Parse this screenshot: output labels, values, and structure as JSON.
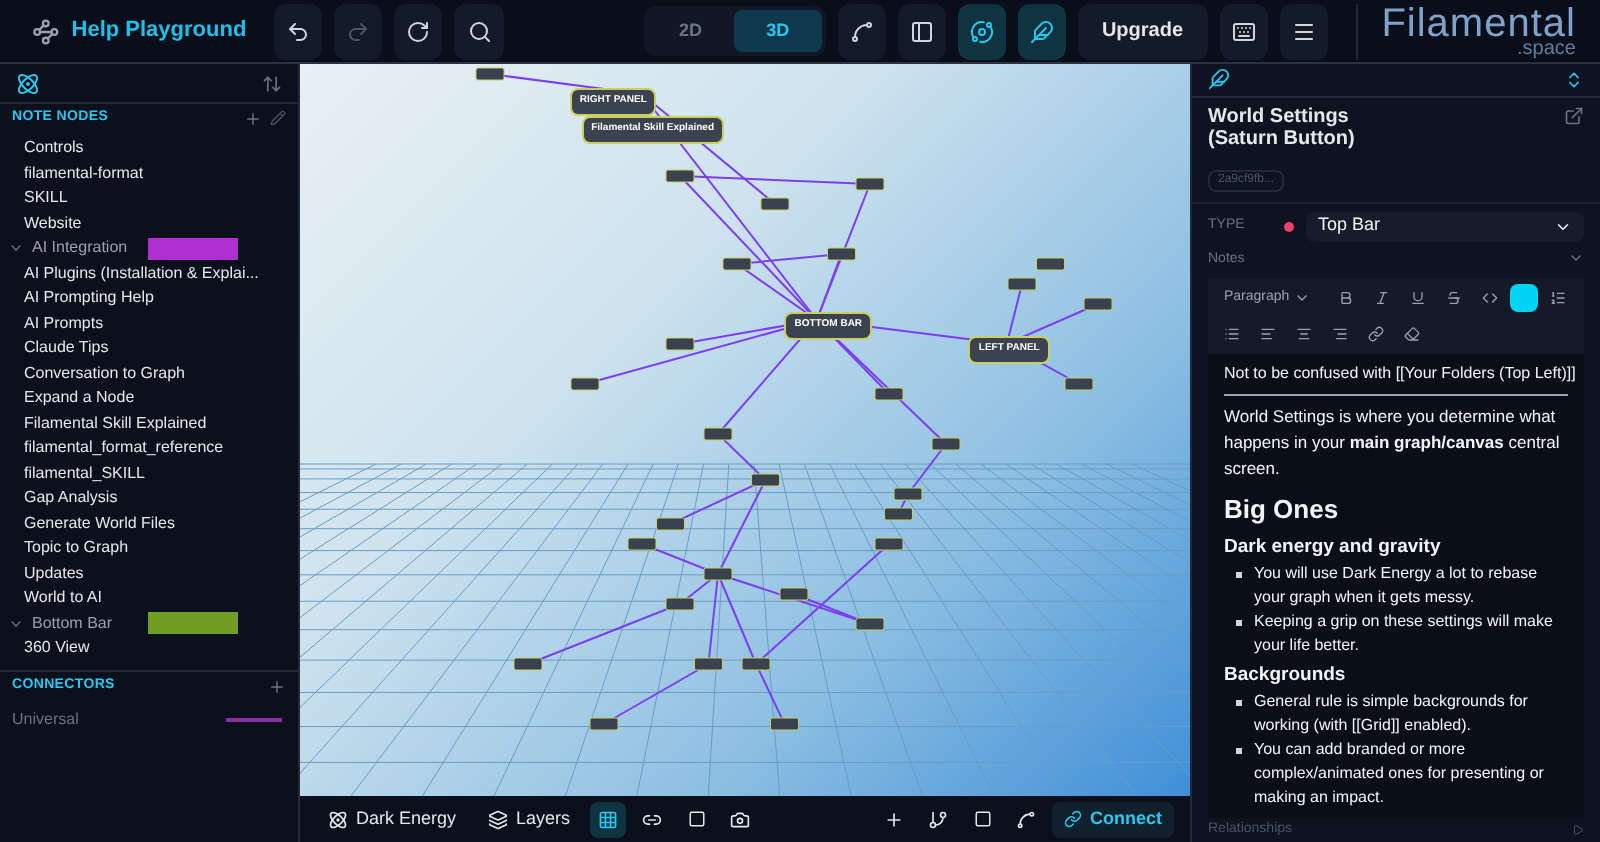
{
  "top_bar": {
    "title": "Help Playground",
    "view_modes": [
      {
        "label": "2D",
        "selected": false
      },
      {
        "label": "3D",
        "selected": true
      }
    ],
    "upgrade": "Upgrade",
    "logo": "Filamental",
    "logo_sub": ".space"
  },
  "sidebar": {
    "sections": [
      {
        "title": "NOTE NODES",
        "items": [
          {
            "kind": "item",
            "label": "Controls"
          },
          {
            "kind": "item",
            "label": "filamental-format"
          },
          {
            "kind": "item",
            "label": "SKILL"
          },
          {
            "kind": "item",
            "label": "Website"
          },
          {
            "kind": "group",
            "label": "AI Integration",
            "color": "#b02fd0",
            "expanded": true,
            "children": [
              {
                "kind": "item",
                "label": "AI Plugins (Installation & Explai..."
              },
              {
                "kind": "item",
                "label": "AI Prompting Help"
              },
              {
                "kind": "item",
                "label": "AI Prompts"
              },
              {
                "kind": "item",
                "label": "Claude Tips"
              },
              {
                "kind": "item",
                "label": "Conversation to Graph"
              },
              {
                "kind": "item",
                "label": "Expand a Node"
              },
              {
                "kind": "item",
                "label": "Filamental Skill Explained"
              },
              {
                "kind": "item",
                "label": "filamental_format_reference"
              },
              {
                "kind": "item",
                "label": "filamental_SKILL"
              },
              {
                "kind": "item",
                "label": "Gap Analysis"
              },
              {
                "kind": "item",
                "label": "Generate World Files"
              },
              {
                "kind": "item",
                "label": "Topic to Graph"
              },
              {
                "kind": "item",
                "label": "Updates"
              },
              {
                "kind": "item",
                "label": "World to AI"
              }
            ]
          },
          {
            "kind": "group",
            "label": "Bottom Bar",
            "color": "#6f9e22",
            "expanded": true,
            "children": [
              {
                "kind": "item",
                "label": "360 View"
              }
            ]
          }
        ]
      },
      {
        "title": "CONNECTORS",
        "items": [
          {
            "kind": "connector",
            "label": "Universal",
            "color": "#8a2fa8"
          }
        ]
      }
    ]
  },
  "canvas": {
    "nodes": [
      {
        "label": "BOTTOM BAR"
      },
      {
        "label": "LEFT PANEL"
      },
      {
        "label": "RIGHT PANEL"
      },
      {
        "label": "Filamental Skill Explained"
      }
    ],
    "toolbar": {
      "dark_energy": "Dark Energy",
      "layers": "Layers",
      "connect": "Connect"
    }
  },
  "inspector": {
    "title": "World Settings (Saturn Button)",
    "id": "2a9cf9fb...",
    "type": {
      "label": "TYPE",
      "value": "Top Bar",
      "color": "#f0406a"
    },
    "notes_label": "Notes",
    "block_style": "Paragraph",
    "content": [
      {
        "kind": "callout",
        "text": "Not to be confused with [[Your Folders (Top Left)]]"
      },
      {
        "kind": "p",
        "text": "World Settings is where you determine what happens in your **main graph/canvas** central screen."
      },
      {
        "kind": "h1",
        "text": "Big Ones"
      },
      {
        "kind": "h2",
        "text": "Dark energy and gravity"
      },
      {
        "kind": "li",
        "text": "You will use Dark Energy a lot to rebase your graph when it gets messy."
      },
      {
        "kind": "li",
        "text": "Keeping a grip on these settings will make your life better."
      },
      {
        "kind": "h2",
        "text": "Backgrounds"
      },
      {
        "kind": "li",
        "text": "General rule is simple backgrounds for working (with [[Grid]] enabled)."
      },
      {
        "kind": "li",
        "text": "You can add branded or more complex/animated ones for presenting or making an impact."
      }
    ],
    "relationships_label": "Relationships"
  }
}
